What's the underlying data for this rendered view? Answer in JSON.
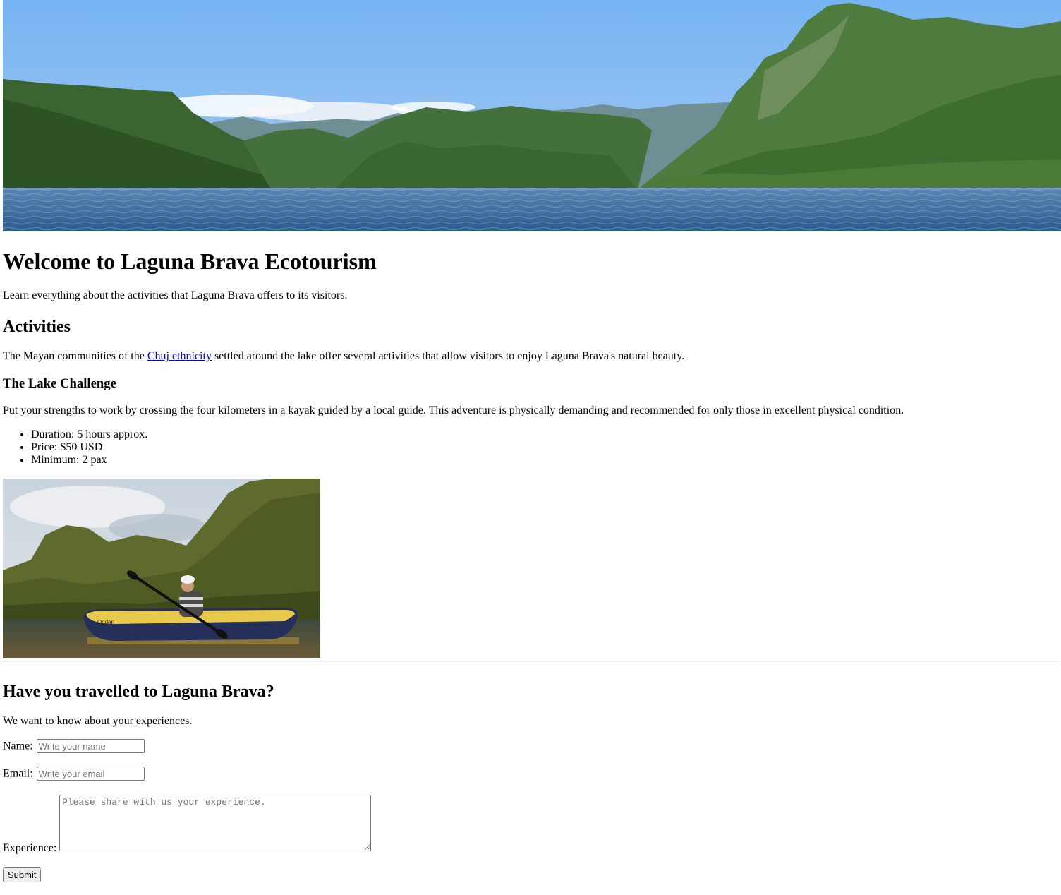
{
  "hero": {
    "image_label": "Laguna Brava lake landscape"
  },
  "intro": {
    "title": "Welcome to Laguna Brava Ecotourism",
    "subtitle": "Learn everything about the activities that Laguna Brava offers to its visitors."
  },
  "activities": {
    "heading": "Activities",
    "text_before_link": "The Mayan communities of the ",
    "link_text": "Chuj ethnicity",
    "text_after_link": " settled around the lake offer several activities that allow visitors to enjoy Laguna Brava's natural beauty.",
    "challenge": {
      "heading": "The Lake Challenge",
      "description": "Put your strengths to work by crossing the four kilometers in a kayak guided by a local guide. This adventure is physically demanding and recommended for only those in excellent physical condition.",
      "details": [
        "Duration: 5 hours approx.",
        "Price: $50 USD",
        "Minimum: 2 pax"
      ],
      "image_label": "Person kayaking on Laguna Brava",
      "kayak_brand": "Ogden"
    }
  },
  "feedback": {
    "heading": "Have you travelled to Laguna Brava?",
    "intro": "We want to know about your experiences.",
    "name_label": "Name:",
    "name_placeholder": "Write your name",
    "email_label": "Email:",
    "email_placeholder": "Write your email",
    "experience_label": "Experience:",
    "experience_placeholder": "Please share with us your experience.",
    "submit_label": "Submit"
  },
  "colors": {
    "link": "#0000ee",
    "sky_top": "#7db8f5",
    "lake": "#3f6d9c",
    "forest": "#2f5a2a"
  }
}
